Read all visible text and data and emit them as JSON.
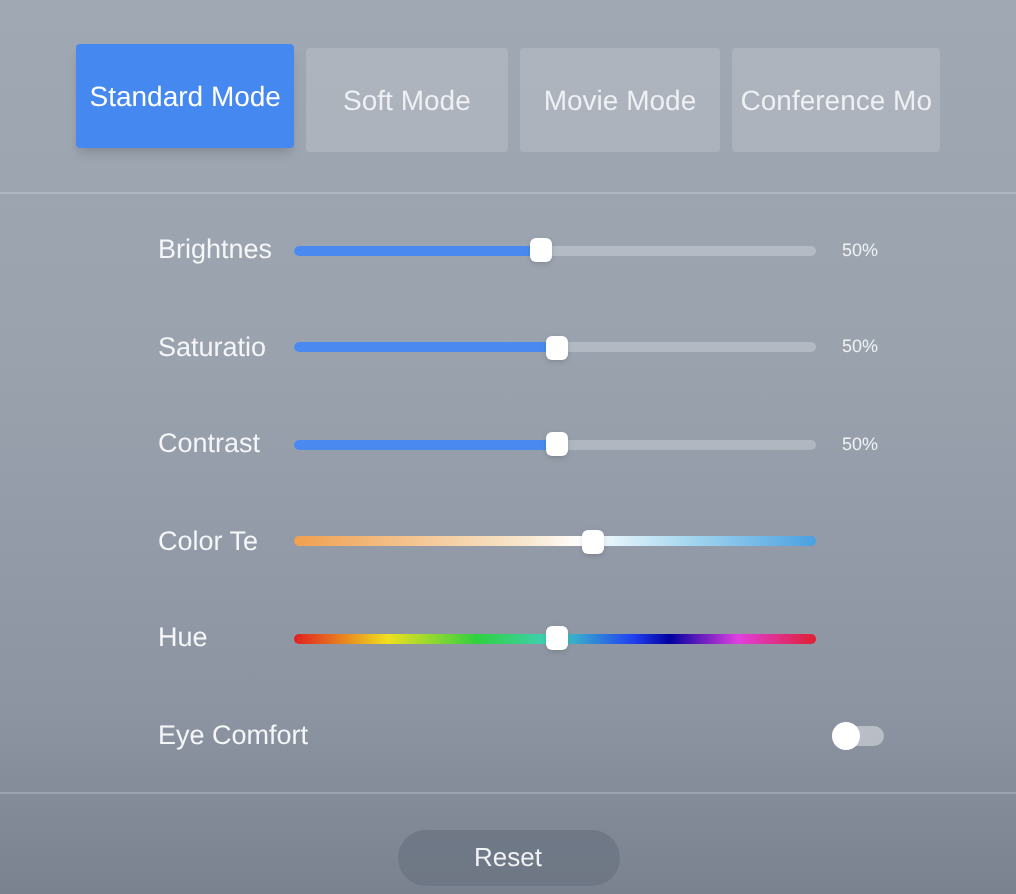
{
  "tabs": [
    {
      "label": "Standard Mode",
      "selected": true
    },
    {
      "label": "Soft Mode",
      "selected": false
    },
    {
      "label": "Movie Mode",
      "selected": false
    },
    {
      "label": "Conference Mo",
      "selected": false
    }
  ],
  "settings": [
    {
      "kind": "plain",
      "label": "Brightnes",
      "level": 0.47,
      "reading": "50%"
    },
    {
      "kind": "plain",
      "label": "Saturatio",
      "level": 0.5,
      "reading": "50%"
    },
    {
      "kind": "plain",
      "label": "Contrast",
      "level": 0.5,
      "reading": "50%"
    },
    {
      "kind": "temperature",
      "label": "Color Te",
      "level": 0.57
    },
    {
      "kind": "hue",
      "label": "Hue",
      "level": 0.5
    },
    {
      "kind": "toggle",
      "label": "Eye Comfort",
      "on": false
    }
  ],
  "reset_button": "Reset"
}
